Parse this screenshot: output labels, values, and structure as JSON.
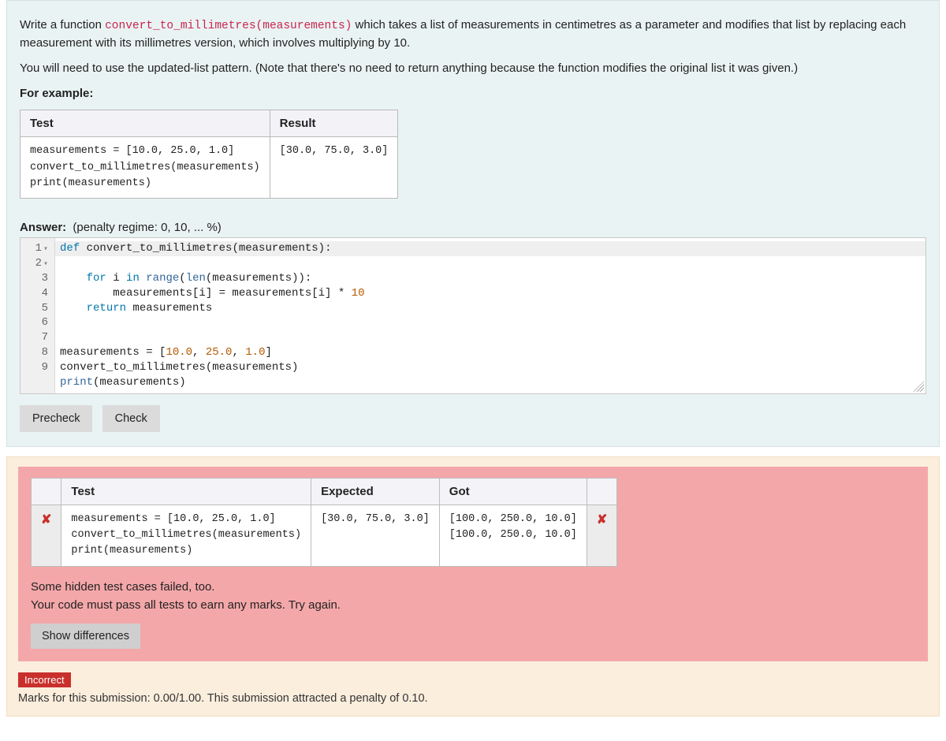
{
  "question": {
    "intro_prefix": "Write a function ",
    "fn_signature": "convert_to_millimetres(measurements)",
    "intro_suffix": " which takes a list of measurements in centimetres as a parameter and modifies that list by replacing each measurement with its millimetres version, which involves multiplying by 10.",
    "para2": "You will need to use the updated-list pattern. (Note that there's no need to return anything because the function modifies the original list it was given.)",
    "for_example": "For example:",
    "example_table": {
      "headers": [
        "Test",
        "Result"
      ],
      "test_code": "measurements = [10.0, 25.0, 1.0]\nconvert_to_millimetres(measurements)\nprint(measurements)",
      "result_code": "[30.0, 75.0, 3.0]"
    }
  },
  "answer": {
    "label": "Answer:",
    "penalty": "(penalty regime: 0, 10, ... %)",
    "code_lines": [
      {
        "n": "1",
        "fold": true,
        "text": "def convert_to_millimetres(measurements):",
        "hl": true
      },
      {
        "n": "2",
        "fold": true,
        "text": "    for i in range(len(measurements)):"
      },
      {
        "n": "3",
        "fold": false,
        "text": "        measurements[i] = measurements[i] * 10"
      },
      {
        "n": "4",
        "fold": false,
        "text": "    return measurements"
      },
      {
        "n": "5",
        "fold": false,
        "text": ""
      },
      {
        "n": "6",
        "fold": false,
        "text": ""
      },
      {
        "n": "7",
        "fold": false,
        "text": "measurements = [10.0, 25.0, 1.0]"
      },
      {
        "n": "8",
        "fold": false,
        "text": "convert_to_millimetres(measurements)"
      },
      {
        "n": "9",
        "fold": false,
        "text": "print(measurements)"
      }
    ]
  },
  "buttons": {
    "precheck": "Precheck",
    "check": "Check"
  },
  "results": {
    "headers": [
      "Test",
      "Expected",
      "Got"
    ],
    "row": {
      "test_code": "measurements = [10.0, 25.0, 1.0]\nconvert_to_millimetres(measurements)\nprint(measurements)",
      "expected": "[30.0, 75.0, 3.0]",
      "got": "[100.0, 250.0, 10.0]\n[100.0, 250.0, 10.0]"
    },
    "msg_line1": "Some hidden test cases failed, too.",
    "msg_line2": "Your code must pass all tests to earn any marks. Try again.",
    "show_diff": "Show differences"
  },
  "grade": {
    "badge": "Incorrect",
    "marks": "Marks for this submission: 0.00/1.00. This submission attracted a penalty of 0.10."
  }
}
